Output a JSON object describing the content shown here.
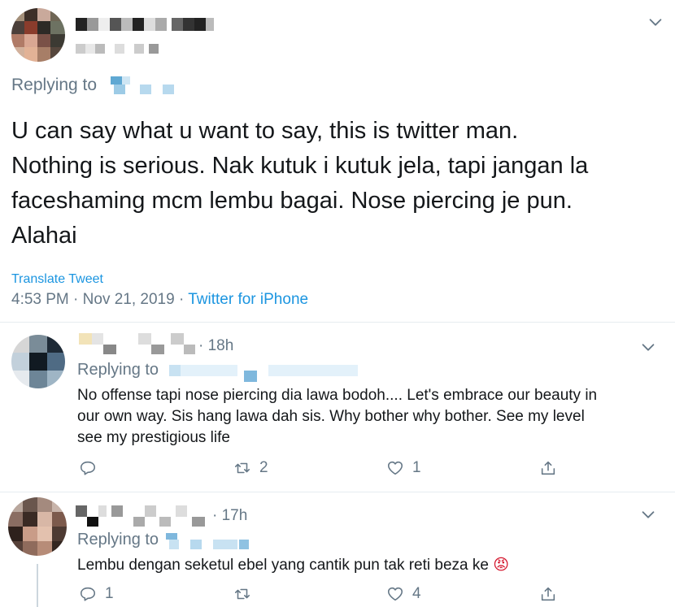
{
  "main_tweet": {
    "replying_to_label": "Replying to",
    "text_lines": [
      "U can say what u want to say, this is twitter man.",
      "Nothing is serious. Nak kutuk i kutuk jela, tapi jangan la",
      "faceshaming mcm lembu bagai. Nose piercing je pun.",
      "Alahai"
    ],
    "translate_label": "Translate Tweet",
    "time": "4:53 PM",
    "separator": "·",
    "date": "Nov 21, 2019",
    "source": "Twitter for iPhone"
  },
  "replies": [
    {
      "time_ago": "· 18h",
      "replying_to_label": "Replying to",
      "text_lines": [
        "No offense tapi nose piercing dia lawa bodoh.... Let's embrace our beauty in",
        "our own way. Sis hang lawa dah sis. Why bother why bother. See my level",
        "see my prestigious life"
      ],
      "reply_count": "",
      "retweet_count": "2",
      "like_count": "1"
    },
    {
      "time_ago": "· 17h",
      "replying_to_label": "Replying to",
      "text": "Lembu dengan seketul ebel yang cantik pun tak reti beza ke",
      "emoji": "😡",
      "reply_count": "1",
      "retweet_count": "",
      "like_count": "4"
    }
  ],
  "icons": {
    "chevron": "chevron-down-icon",
    "reply": "reply-icon",
    "retweet": "retweet-icon",
    "like": "heart-icon",
    "share": "share-icon"
  },
  "colors": {
    "link": "#1b95e0",
    "muted": "#657786",
    "text": "#14171a",
    "divider": "#e6ecf0"
  }
}
